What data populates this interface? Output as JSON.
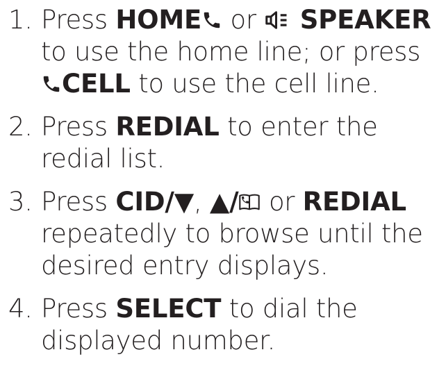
{
  "steps": [
    {
      "number": "1.",
      "press": "Press",
      "home": "HOME",
      "or1": "or",
      "speaker": "SPEAKER",
      "line2": "to use the home line; or press",
      "cell": "CELL",
      "line3_rest": "to use the cell line."
    },
    {
      "number": "2.",
      "press": "Press",
      "key": "REDIAL",
      "rest": "to enter the",
      "line2": "redial list."
    },
    {
      "number": "3.",
      "press": "Press",
      "cid": "CID/▼",
      "comma": ",",
      "up": "▲/",
      "or": "or",
      "redial": "REDIAL",
      "line2": "repeatedly to browse until the",
      "line3": "desired entry displays."
    },
    {
      "number": "4.",
      "press": "Press",
      "key": "SELECT",
      "rest": "to dial the",
      "line2": "displayed number."
    }
  ],
  "icons": {
    "home": "phone-handset-icon",
    "speaker": "speaker-icon",
    "cell": "phone-handset-icon",
    "directory": "phonebook-icon"
  }
}
